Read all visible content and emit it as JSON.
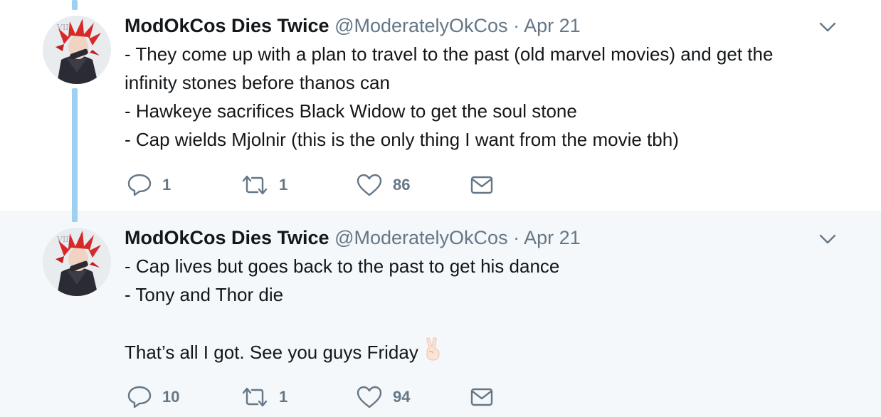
{
  "tweets": [
    {
      "display_name": "ModOkCos Dies Twice",
      "handle": "@ModeratelyOkCos",
      "separator": "·",
      "date": "Apr 21",
      "lines": [
        "- They come up with a plan to travel to the past (old marvel movies) and get the",
        "infinity stones before thanos can",
        "- Hawkeye sacrifices Black Widow to get the soul stone",
        "- Cap wields Mjolnir (this is the only thing I want from the movie tbh)"
      ],
      "reply_count": "1",
      "retweet_count": "1",
      "like_count": "86",
      "icons": [
        "reply-icon",
        "retweet-icon",
        "like-icon",
        "direct-message-icon",
        "chevron-down-icon"
      ]
    },
    {
      "display_name": "ModOkCos Dies Twice",
      "handle": "@ModeratelyOkCos",
      "separator": "·",
      "date": "Apr 21",
      "lines": [
        "- Cap lives but goes back to the past to get his dance",
        "- Tony and Thor die",
        "",
        "That’s all I got. See you guys Friday"
      ],
      "emoji": "victory-hand-emoji",
      "reply_count": "10",
      "retweet_count": "1",
      "like_count": "94",
      "icons": [
        "reply-icon",
        "retweet-icon",
        "like-icon",
        "direct-message-icon",
        "chevron-down-icon"
      ]
    }
  ],
  "colors": {
    "thread_line": "#9ed0f2",
    "muted_text": "#657786",
    "primary_text": "#14171a",
    "reply_background": "#f5f8fa"
  }
}
